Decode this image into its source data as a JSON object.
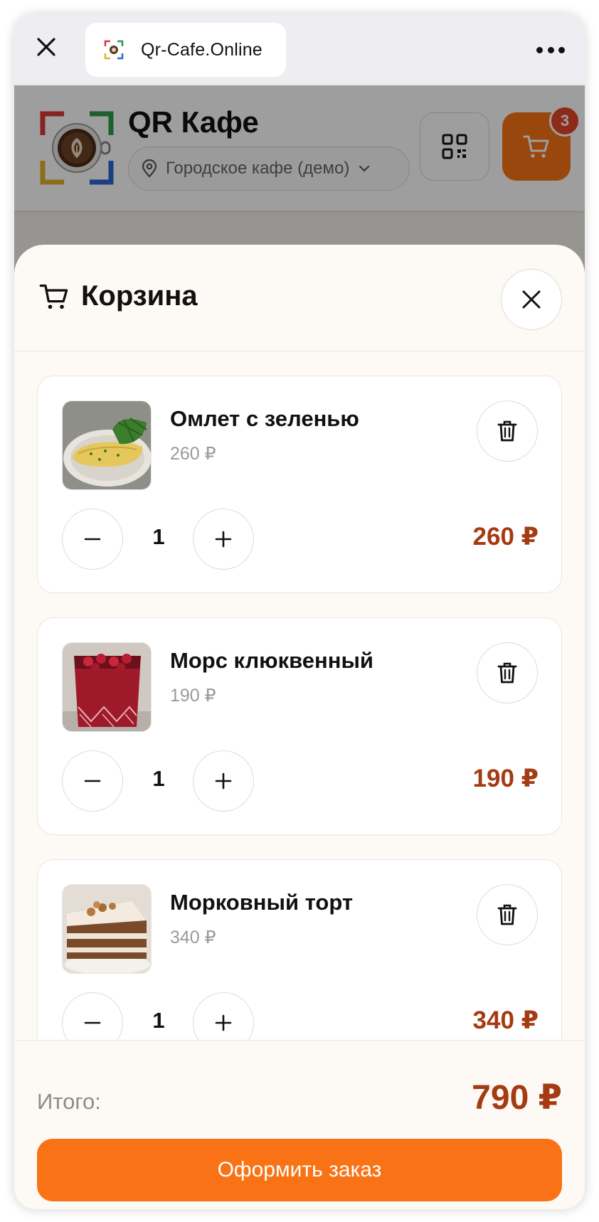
{
  "browser": {
    "url": "Qr-Cafe.Online",
    "close_icon": "close-icon",
    "more_icon": "more-horizontal-icon"
  },
  "site": {
    "title": "QR Кафе",
    "location": "Городское кафе (демо)",
    "cart_count": "3",
    "accent_color": "#f97316"
  },
  "cart": {
    "title": "Корзина",
    "items": [
      {
        "name": "Омлет с зеленью",
        "unit_price": "260 ₽",
        "quantity": "1",
        "total": "260 ₽",
        "image": "omelette-photo"
      },
      {
        "name": "Морс клюквенный",
        "unit_price": "190 ₽",
        "quantity": "1",
        "total": "190 ₽",
        "image": "cranberry-drink-photo"
      },
      {
        "name": "Морковный торт",
        "unit_price": "340 ₽",
        "quantity": "1",
        "total": "340 ₽",
        "image": "carrot-cake-photo"
      }
    ],
    "total_label": "Итого:",
    "total_value": "790 ₽",
    "checkout_label": "Оформить заказ",
    "price_color": "#a43b12"
  }
}
